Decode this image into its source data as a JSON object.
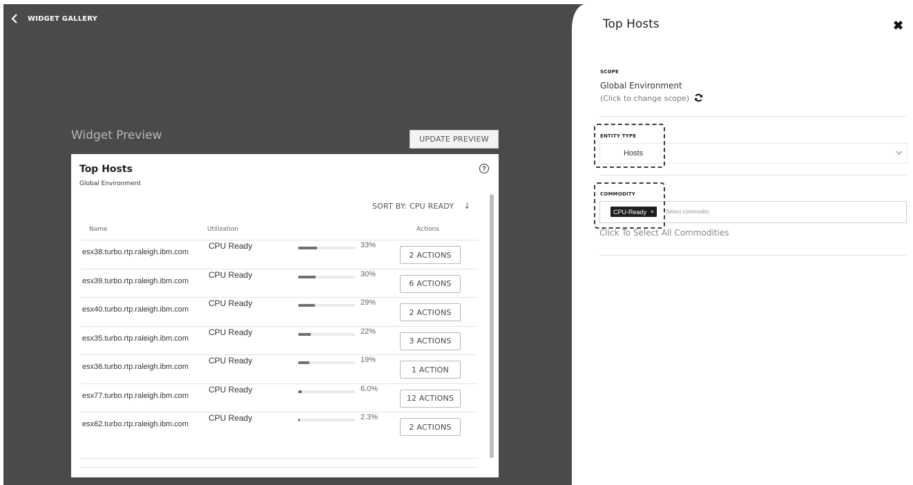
{
  "header": {
    "back_label": "WIDGET GALLERY"
  },
  "preview": {
    "title": "Widget Preview",
    "update_button": "UPDATE PREVIEW"
  },
  "widget": {
    "title": "Top Hosts",
    "subtitle": "Global Environment",
    "help_icon": "?",
    "sort_label": "SORT BY: CPU READY",
    "sort_arrow": "↓",
    "columns": {
      "name": "Name",
      "utilization": "Utilization",
      "actions": "Actions"
    },
    "rows": [
      {
        "name": "esx38.turbo.rtp.raleigh.ibm.com",
        "commodity": "CPU Ready",
        "percent": "33%",
        "fraction": 0.33,
        "actions": "2 ACTIONS"
      },
      {
        "name": "esx39.turbo.rtp.raleigh.ibm.com",
        "commodity": "CPU Ready",
        "percent": "30%",
        "fraction": 0.3,
        "actions": "6 ACTIONS"
      },
      {
        "name": "esx40.turbo.rtp.raleigh.ibm.com",
        "commodity": "CPU Ready",
        "percent": "29%",
        "fraction": 0.29,
        "actions": "2 ACTIONS"
      },
      {
        "name": "esx35.turbo.rtp.raleigh.ibm.com",
        "commodity": "CPU Ready",
        "percent": "22%",
        "fraction": 0.22,
        "actions": "3 ACTIONS"
      },
      {
        "name": "esx36.turbo.rtp.raleigh.ibm.com",
        "commodity": "CPU Ready",
        "percent": "19%",
        "fraction": 0.19,
        "actions": "1 ACTION"
      },
      {
        "name": "esx77.turbo.rtp.raleigh.ibm.com",
        "commodity": "CPU Ready",
        "percent": "6.0%",
        "fraction": 0.06,
        "actions": "12 ACTIONS"
      },
      {
        "name": "esx62.turbo.rtp.raleigh.ibm.com",
        "commodity": "CPU Ready",
        "percent": "2.3%",
        "fraction": 0.023,
        "actions": "2 ACTIONS"
      }
    ]
  },
  "panel": {
    "title": "Top Hosts",
    "close_icon": "✖",
    "scope": {
      "label": "SCOPE",
      "value": "Global Environment",
      "hint": "(Click to change scope)"
    },
    "entity_type": {
      "label": "ENTITY TYPE",
      "value": "Hosts"
    },
    "commodity": {
      "label": "COMMODITY",
      "tag": "CPU-Ready",
      "tag_remove": "×",
      "placeholder": "Select commodity",
      "select_all": "Click To Select All Commodities"
    }
  },
  "icons": {
    "back": "chevron-left-icon",
    "refresh": "refresh-icon",
    "help": "help-icon",
    "close": "close-icon",
    "dropdown": "chevron-down-icon"
  }
}
